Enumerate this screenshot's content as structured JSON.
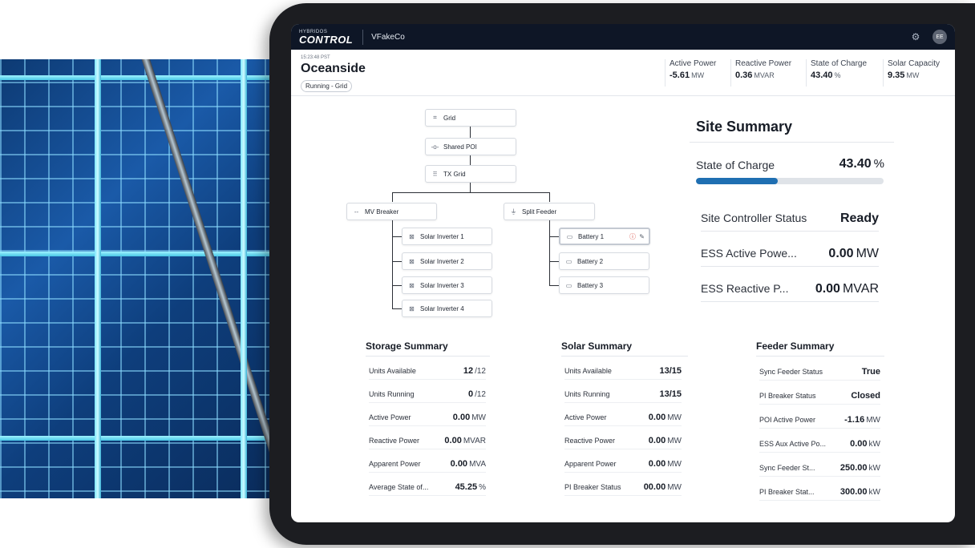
{
  "app": {
    "logo_small": "HYBRIDOS",
    "logo_big": "CONTROL",
    "company": "VFakeCo",
    "user_initials": "EE"
  },
  "site": {
    "time": "15:23:48 PST",
    "name": "Oceanside",
    "status": "Running - Grid"
  },
  "metrics": [
    {
      "label": "Active Power",
      "value": "-5.61",
      "unit": "MW"
    },
    {
      "label": "Reactive Power",
      "value": "0.36",
      "unit": "MVAR"
    },
    {
      "label": "State of Charge",
      "value": "43.40",
      "unit": "%"
    },
    {
      "label": "Solar Capacity",
      "value": "9.35",
      "unit": "MW"
    }
  ],
  "diagram": {
    "grid": "Grid",
    "shared_poi": "Shared POI",
    "tx_grid": "TX Grid",
    "mv_breaker": "MV Breaker",
    "split_feeder": "Split Feeder",
    "inverters": [
      "Solar Inverter 1",
      "Solar Inverter 2",
      "Solar Inverter 3",
      "Solar Inverter 4"
    ],
    "batteries": [
      "Battery 1",
      "Battery 2",
      "Battery 3"
    ]
  },
  "site_summary": {
    "title": "Site Summary",
    "soc_label": "State of Charge",
    "soc_value": "43.40",
    "soc_unit": "%",
    "soc_fraction": 0.434,
    "rows": [
      {
        "label": "Site Controller Status",
        "value": "Ready",
        "unit": ""
      },
      {
        "label": "ESS Active Powe...",
        "value": "0.00",
        "unit": "MW"
      },
      {
        "label": "ESS Reactive P...",
        "value": "0.00",
        "unit": "MVAR"
      }
    ]
  },
  "storage_summary": {
    "title": "Storage Summary",
    "rows": [
      {
        "label": "Units Available",
        "value": "12",
        "unit": "/12"
      },
      {
        "label": "Units Running",
        "value": "0",
        "unit": "/12"
      },
      {
        "label": "Active Power",
        "value": "0.00",
        "unit": "MW"
      },
      {
        "label": "Reactive Power",
        "value": "0.00",
        "unit": "MVAR"
      },
      {
        "label": "Apparent Power",
        "value": "0.00",
        "unit": "MVA"
      },
      {
        "label": "Average State of...",
        "value": "45.25",
        "unit": "%"
      }
    ]
  },
  "solar_summary": {
    "title": "Solar Summary",
    "rows": [
      {
        "label": "Units Available",
        "value": "13/15",
        "unit": ""
      },
      {
        "label": "Units Running",
        "value": "13/15",
        "unit": ""
      },
      {
        "label": "Active Power",
        "value": "0.00",
        "unit": "MW"
      },
      {
        "label": "Reactive Power",
        "value": "0.00",
        "unit": "MW"
      },
      {
        "label": "Apparent Power",
        "value": "0.00",
        "unit": "MW"
      },
      {
        "label": "PI Breaker Status",
        "value": "00.00",
        "unit": "MW"
      }
    ]
  },
  "feeder_summary": {
    "title": "Feeder Summary",
    "rows": [
      {
        "label": "Sync Feeder Status",
        "value": "True",
        "unit": ""
      },
      {
        "label": "PI Breaker Status",
        "value": "Closed",
        "unit": ""
      },
      {
        "label": "POI Active Power",
        "value": "-1.16",
        "unit": "MW"
      },
      {
        "label": "ESS Aux Active Po...",
        "value": "0.00",
        "unit": "kW"
      },
      {
        "label": "Sync Feeder St...",
        "value": "250.00",
        "unit": "kW"
      },
      {
        "label": "PI Breaker Stat...",
        "value": "300.00",
        "unit": "kW"
      }
    ]
  },
  "colors": {
    "appbar": "#0e1626",
    "accent": "#1f6fb2",
    "alert": "#d23a2e"
  },
  "icons": [
    "gear-icon",
    "grid-tower-icon",
    "poi-icon",
    "tx-grid-icon",
    "breaker-icon",
    "plug-icon",
    "inverter-icon",
    "battery-icon",
    "warning-icon",
    "wrench-icon"
  ]
}
